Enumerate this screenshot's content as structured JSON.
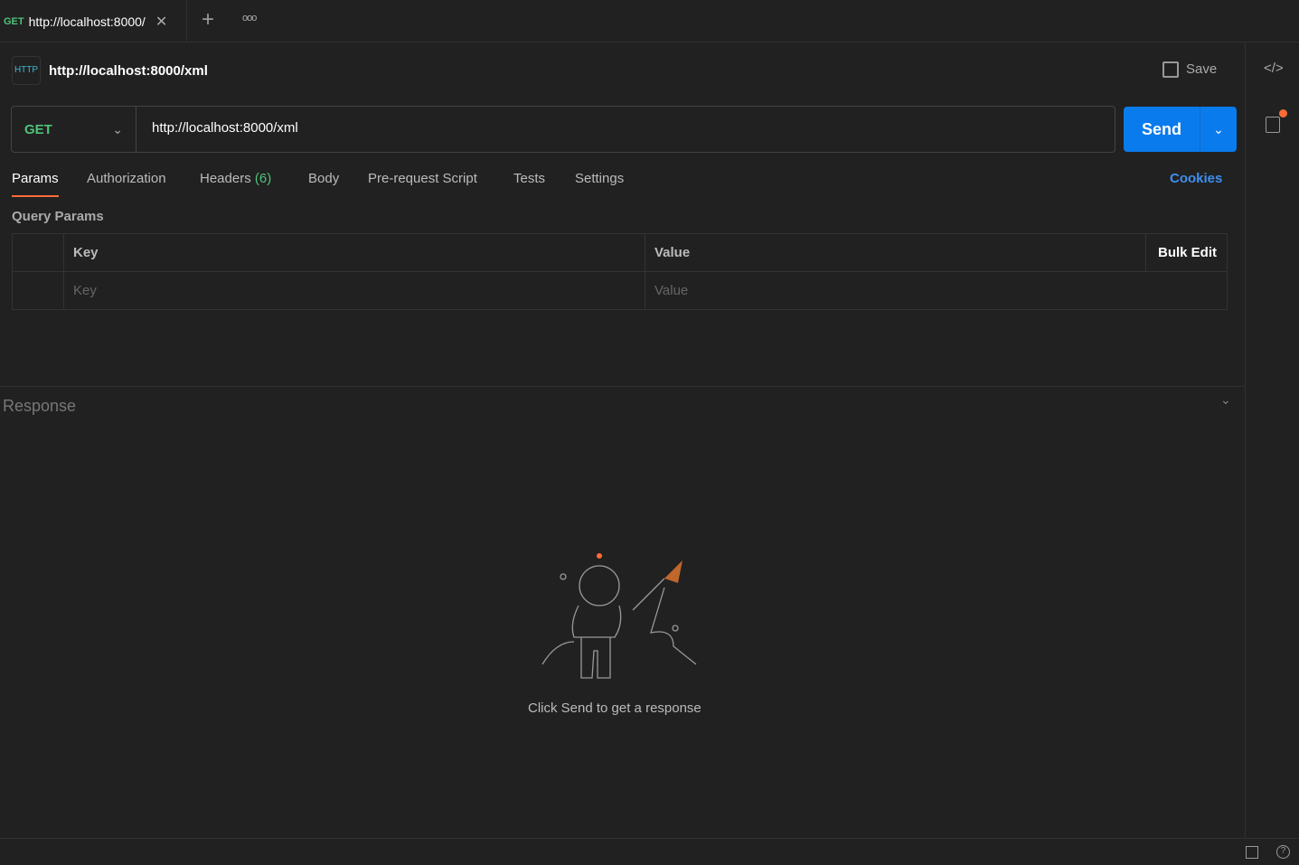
{
  "tab": {
    "method": "GET",
    "title": "http://localhost:8000/"
  },
  "request": {
    "title": "http://localhost:8000/xml",
    "save_label": "Save",
    "method": "GET",
    "url": "http://localhost:8000/xml",
    "send_label": "Send"
  },
  "subtabs": [
    "Params",
    "Authorization",
    "Headers",
    "Body",
    "Pre-request Script",
    "Tests",
    "Settings"
  ],
  "headers_count": "(6)",
  "cookies_label": "Cookies",
  "query_params": {
    "title": "Query Params",
    "key_header": "Key",
    "value_header": "Value",
    "bulk_edit": "Bulk Edit",
    "key_placeholder": "Key",
    "value_placeholder": "Value"
  },
  "response": {
    "title": "Response",
    "empty_message": "Click Send to get a response"
  },
  "colors": {
    "accent": "#097bed",
    "get": "#4fc27a",
    "notification": "#ff6c37"
  }
}
